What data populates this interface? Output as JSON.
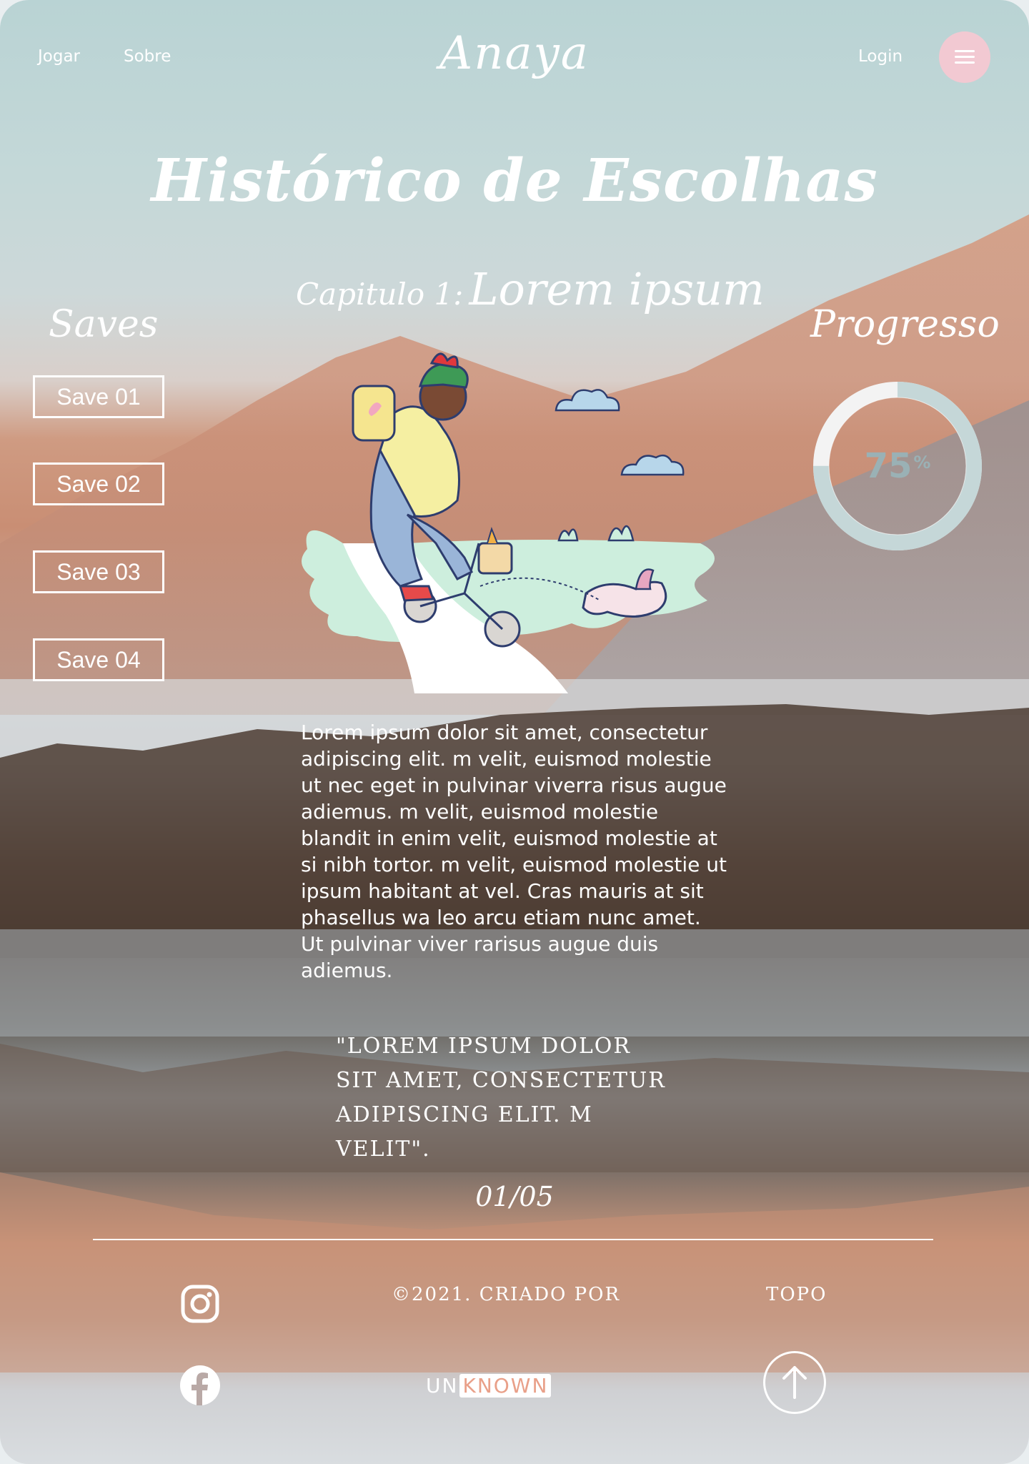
{
  "nav": {
    "links": [
      "Jogar",
      "Sobre"
    ],
    "logo": "Anaya",
    "login": "Login"
  },
  "page_title": "Histórico de Escolhas",
  "chapter": {
    "prefix": "Capitulo 1:",
    "title": "Lorem ipsum"
  },
  "saves": {
    "title": "Saves",
    "items": [
      "Save 01",
      "Save 02",
      "Save 03",
      "Save 04"
    ],
    "selected": "Save 03"
  },
  "progress": {
    "title": "Progresso",
    "value": "75",
    "unit": "%",
    "fraction": 0.75
  },
  "body_text": "Lorem ipsum dolor sit amet, consectetur adipiscing elit. m velit, euismod molestie ut nec eget in pulvinar viverra risus augue adiemus. m velit, euismod molestie blandit in enim velit, euismod molestie at si  nibh tortor. m velit, euismod molestie ut ipsum habitant at vel. Cras mauris at sit phasellus wa leo arcu etiam nunc amet. Ut   pulvinar viver rarisus augue duis adiemus.",
  "quote": "\"Lorem ipsum dolor sit amet, consectetur adipiscing elit. m velit\".",
  "pager": "01/05",
  "footer": {
    "copyright": "©2021. Criado por",
    "top_label": "Topo",
    "brand": {
      "un": "UN",
      "know": "KNOWN"
    }
  },
  "colors": {
    "accent_pink": "#f2c9d2",
    "progress_track": "#c5d7d8",
    "progress_rest": "#f3f3f3",
    "brand_orange": "#e9a089"
  },
  "icons": [
    "menu-icon",
    "instagram-icon",
    "facebook-icon",
    "arrow-up-icon"
  ]
}
